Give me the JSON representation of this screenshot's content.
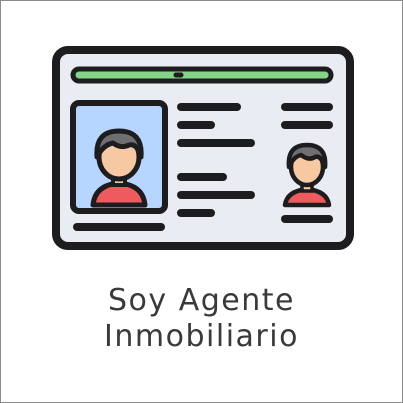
{
  "tile": {
    "label_line1": "Soy Agente",
    "label_line2": "Inmobiliario",
    "icon": "id-card-icon"
  },
  "colors": {
    "outline": "#1d1d1f",
    "card_fill": "#e9edf3",
    "stripe": "#86d38a",
    "photo_bg": "#b7d6ff",
    "skin": "#f7c9a2",
    "hair": "#6f6f73",
    "shirt": "#ef5a5f",
    "label_text": "#3a3a3a"
  }
}
